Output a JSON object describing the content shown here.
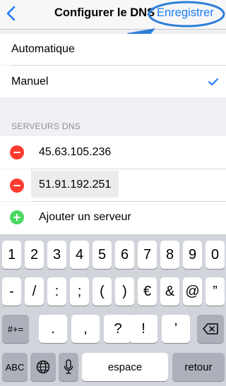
{
  "navbar": {
    "title": "Configurer le DNS",
    "save_label": "Enregistrer",
    "accent": "#1a7df5"
  },
  "mode": {
    "options": [
      {
        "label": "Automatique",
        "selected": false
      },
      {
        "label": "Manuel",
        "selected": true
      }
    ]
  },
  "dns": {
    "header": "SERVEURS DNS",
    "servers": [
      "45.63.105.236",
      "51.91.192.251"
    ],
    "add_label": "Ajouter un serveur"
  },
  "keyboard": {
    "row1": [
      "1",
      "2",
      "3",
      "4",
      "5",
      "6",
      "7",
      "8",
      "9",
      "0"
    ],
    "row2": [
      "-",
      "/",
      ":",
      ";",
      "(",
      ")",
      "€",
      "&",
      "@",
      "”"
    ],
    "row3_left": "#+=",
    "row3": [
      ".",
      ",",
      "?",
      "!",
      "’"
    ],
    "abc": "ABC",
    "space": "espace",
    "return": "retour"
  }
}
